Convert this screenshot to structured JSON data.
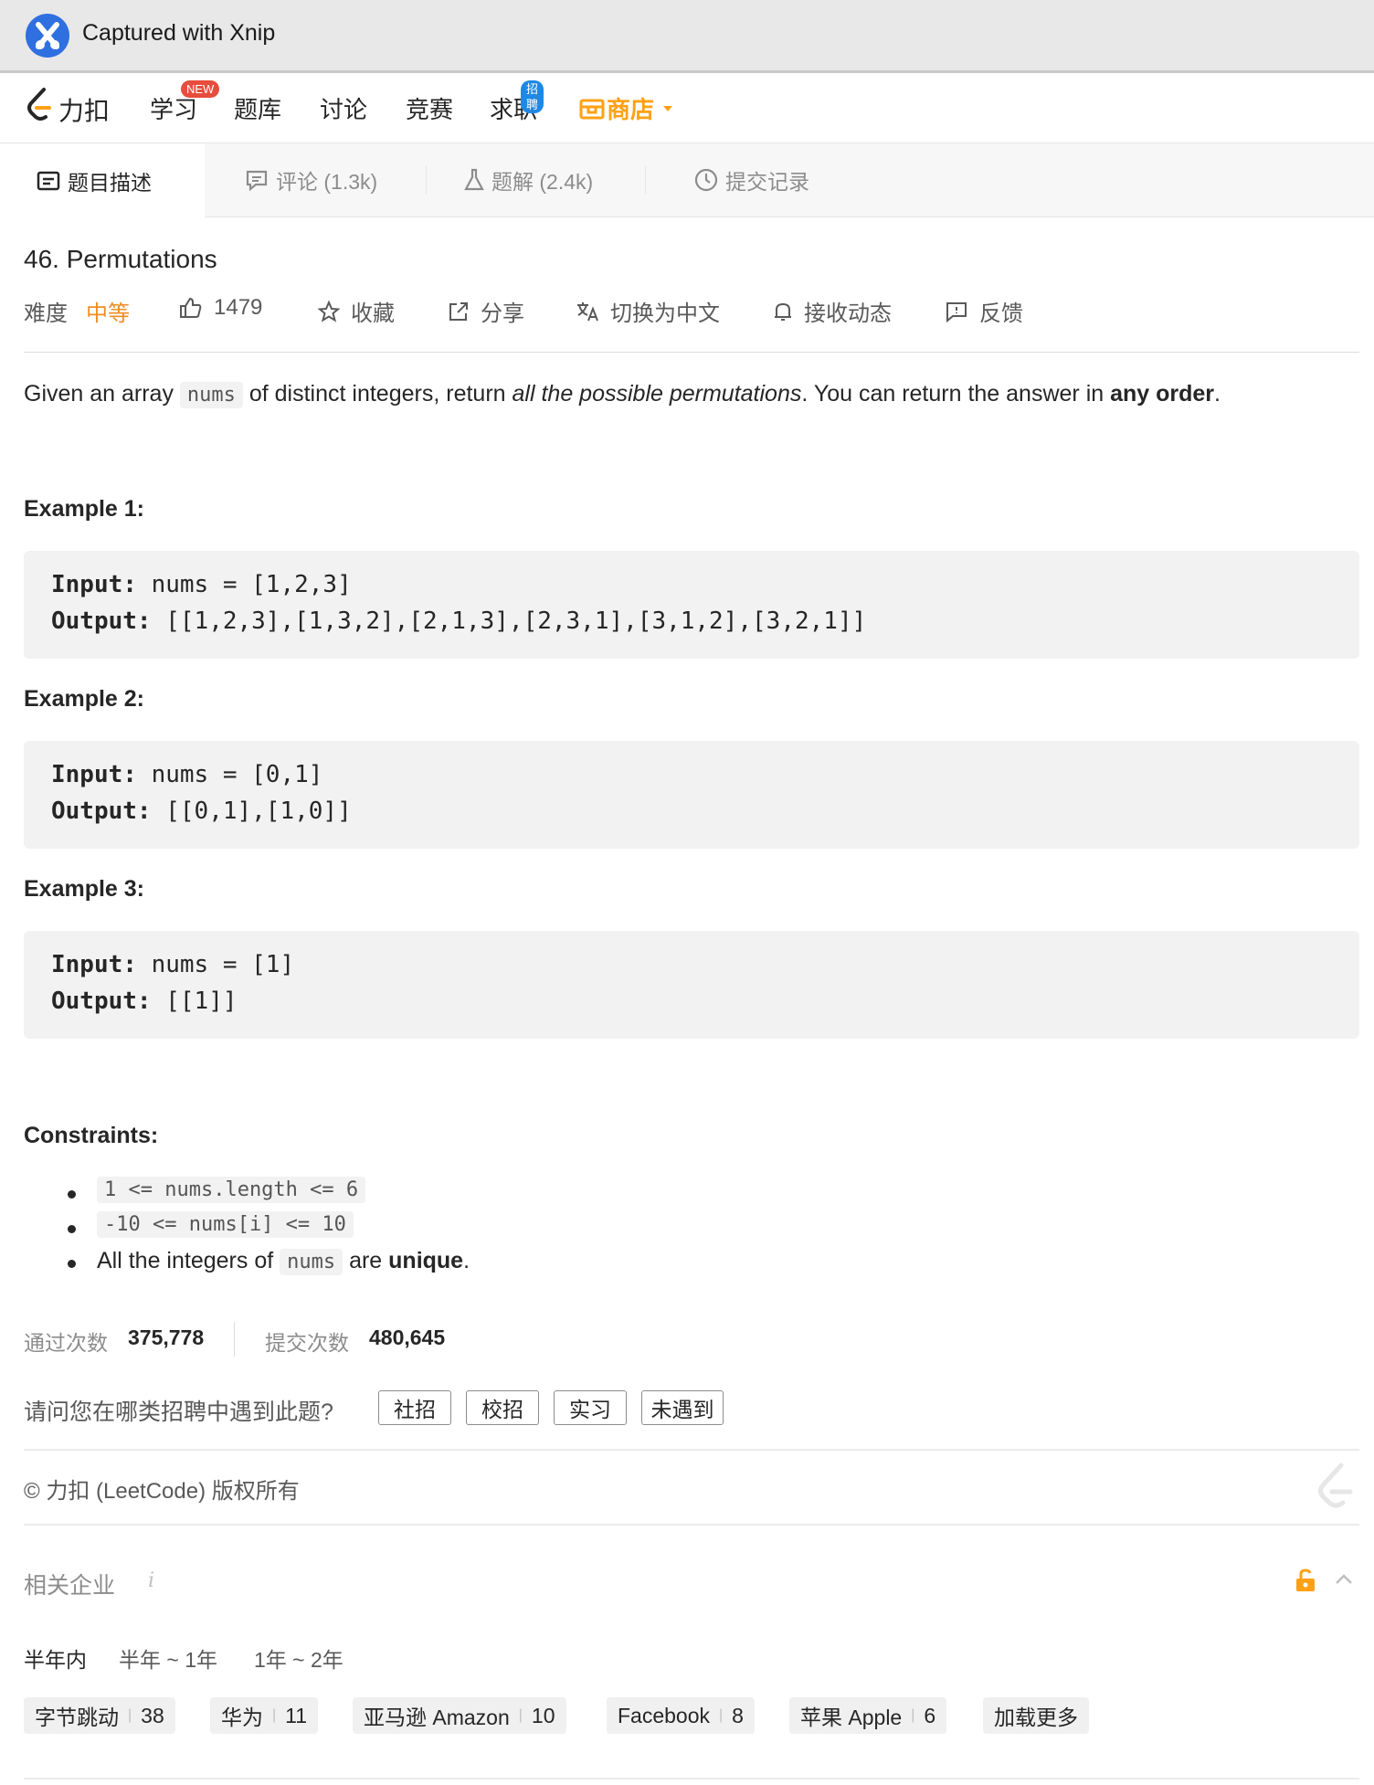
{
  "xnip": {
    "title": "Captured with Xnip"
  },
  "nav": {
    "logo_text": "力扣",
    "items": [
      {
        "label": "学习",
        "badge": "NEW",
        "badge_color": "#e74c3c"
      },
      {
        "label": "题库"
      },
      {
        "label": "讨论"
      },
      {
        "label": "竞赛"
      },
      {
        "label": "求职",
        "badge": "招聘",
        "badge_color": "#1e88e5"
      }
    ],
    "shop_label": "商店",
    "shop_color": "#ffa116"
  },
  "tabs": [
    {
      "label": "题目描述",
      "icon": "description-icon",
      "active": true
    },
    {
      "label": "评论 (1.3k)",
      "icon": "comment-icon"
    },
    {
      "label": "题解 (2.4k)",
      "icon": "flask-icon"
    },
    {
      "label": "提交记录",
      "icon": "clock-icon"
    }
  ],
  "problem": {
    "title": "46. Permutations",
    "difficulty_label": "难度",
    "difficulty": "中等",
    "difficulty_color": "#ef8d28",
    "likes": "1479",
    "actions": {
      "favorite": "收藏",
      "share": "分享",
      "switch_lang": "切换为中文",
      "subscribe": "接收动态",
      "feedback": "反馈"
    },
    "description": {
      "pre": "Given an array",
      "code": "nums",
      "mid": "of distinct integers, return",
      "em": "all the possible permutations",
      "post": ". You can return the answer in",
      "strong": "any order",
      "end": "."
    },
    "examples": [
      {
        "heading": "Example 1:",
        "input_label": "Input:",
        "input": " nums = [1,2,3]",
        "output_label": "Output:",
        "output": " [[1,2,3],[1,3,2],[2,1,3],[2,3,1],[3,1,2],[3,2,1]]"
      },
      {
        "heading": "Example 2:",
        "input_label": "Input:",
        "input": " nums = [0,1]",
        "output_label": "Output:",
        "output": " [[0,1],[1,0]]"
      },
      {
        "heading": "Example 3:",
        "input_label": "Input:",
        "input": " nums = [1]",
        "output_label": "Output:",
        "output": " [[1]]"
      }
    ],
    "constraints_heading": "Constraints:",
    "constraints": {
      "c1": "1 <= nums.length <= 6",
      "c2": "-10 <= nums[i] <= 10",
      "c3_pre": "All the integers of",
      "c3_code": "nums",
      "c3_mid": "are",
      "c3_strong": "unique",
      "c3_end": "."
    }
  },
  "stats": {
    "accepted_label": "通过次数",
    "accepted": "375,778",
    "submissions_label": "提交次数",
    "submissions": "480,645"
  },
  "survey": {
    "question": "请问您在哪类招聘中遇到此题?",
    "options": [
      "社招",
      "校招",
      "实习",
      "未遇到"
    ]
  },
  "copyright": "© 力扣 (LeetCode) 版权所有",
  "companies": {
    "heading": "相关企业",
    "info": "i",
    "periods": [
      "半年内",
      "半年 ~ 1年",
      "1年 ~ 2年"
    ],
    "list": [
      {
        "name": "字节跳动",
        "count": "38"
      },
      {
        "name": "华为",
        "count": "11"
      },
      {
        "name": "亚马逊 Amazon",
        "count": "10"
      },
      {
        "name": "Facebook",
        "count": "8"
      },
      {
        "name": "苹果 Apple",
        "count": "6"
      }
    ],
    "load_more": "加载更多"
  }
}
